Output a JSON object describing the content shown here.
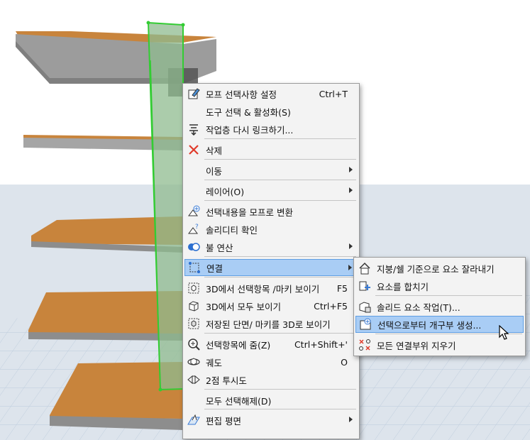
{
  "main_menu": [
    {
      "label": "모프 선택사항 설정",
      "shortcut": "Ctrl+T",
      "icon": "morph-settings-icon",
      "arrow": false
    },
    {
      "label": "도구 선택 & 활성화(S)",
      "shortcut": "",
      "icon": "",
      "arrow": false
    },
    {
      "label": "작업층 다시 링크하기...",
      "shortcut": "",
      "icon": "relink-story-icon",
      "arrow": false
    },
    {
      "label": "삭제",
      "shortcut": "",
      "icon": "delete-icon",
      "arrow": false
    },
    {
      "label": "이동",
      "shortcut": "",
      "icon": "",
      "arrow": true
    },
    {
      "label": "레이어(O)",
      "shortcut": "",
      "icon": "",
      "arrow": true
    },
    {
      "label": "선택내용을 모프로 변환",
      "shortcut": "",
      "icon": "convert-to-morph-icon",
      "arrow": false
    },
    {
      "label": "솔리디티 확인",
      "shortcut": "",
      "icon": "check-solidity-icon",
      "arrow": false
    },
    {
      "label": "불 연산",
      "shortcut": "",
      "icon": "boolean-icon",
      "arrow": true
    },
    {
      "label": "연결",
      "shortcut": "",
      "icon": "connect-icon",
      "arrow": true
    },
    {
      "label": "3D에서 선택항목 /마키 보이기",
      "shortcut": "F5",
      "icon": "show-selection-3d-icon",
      "arrow": false
    },
    {
      "label": "3D에서 모두 보이기",
      "shortcut": "Ctrl+F5",
      "icon": "show-all-3d-icon",
      "arrow": false
    },
    {
      "label": "저장된 단면/ 마키를 3D로 보이기",
      "shortcut": "",
      "icon": "saved-cut-3d-icon",
      "arrow": false
    },
    {
      "label": "선택항목에 줌(Z)",
      "shortcut": "Ctrl+Shift+'",
      "icon": "zoom-selection-icon",
      "arrow": false
    },
    {
      "label": "궤도",
      "shortcut": "O",
      "icon": "orbit-icon",
      "arrow": false
    },
    {
      "label": "2점 투시도",
      "shortcut": "",
      "icon": "two-point-perspective-icon",
      "arrow": false
    },
    {
      "label": "모두 선택해제(D)",
      "shortcut": "",
      "icon": "",
      "arrow": false
    },
    {
      "label": "편집 평면",
      "shortcut": "",
      "icon": "edit-plane-icon",
      "arrow": true
    }
  ],
  "sub_menu": [
    {
      "label": "지붕/쉘 기준으로 요소 잘라내기",
      "icon": "trim-roof-icon"
    },
    {
      "label": "요소를 합치기",
      "icon": "merge-elements-icon"
    },
    {
      "label": "솔리드 요소 작업(T)...",
      "icon": "solid-operations-icon"
    },
    {
      "label": "선택으로부터 개구부 생성...",
      "icon": "create-opening-icon"
    },
    {
      "label": "모든 연결부위 지우기",
      "icon": "remove-connections-icon"
    }
  ],
  "highlight": {
    "main_index": 9,
    "sub_index": 3
  },
  "colors": {
    "menu_bg": "#f3f3f3",
    "highlight": "#a9cdf5",
    "highlight_border": "#5f9ee3",
    "slab_top": "#c8843c",
    "slab_side": "#9c9c9c",
    "selection": "#33cc33"
  }
}
